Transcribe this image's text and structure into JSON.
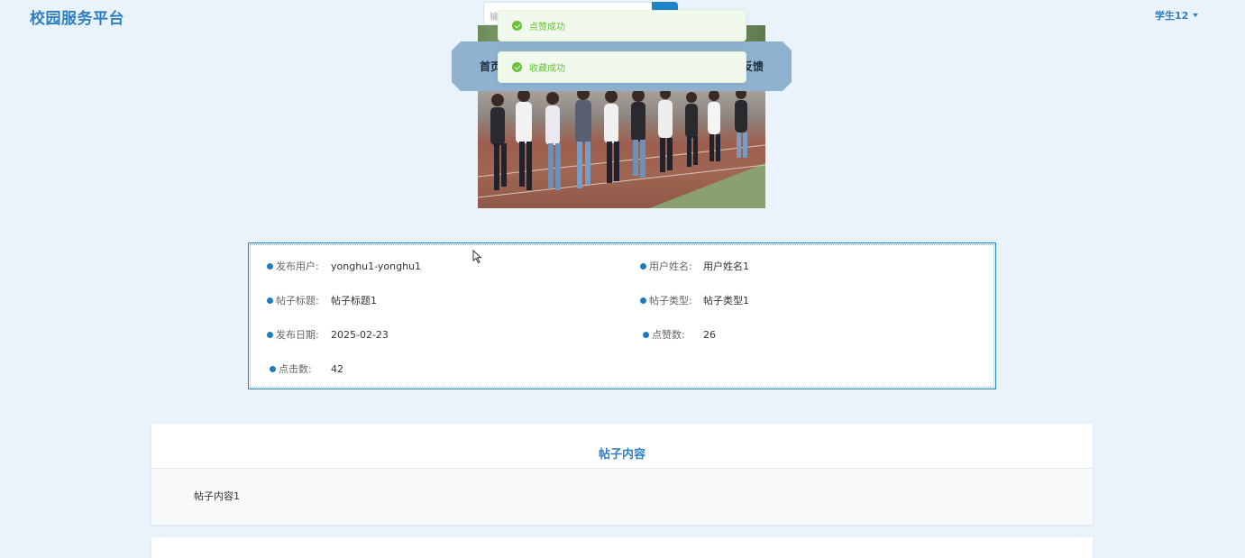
{
  "header": {
    "brand": "校园服务平台",
    "user_label": "学生12",
    "search_placeholder": "输入"
  },
  "nav": {
    "items": [
      {
        "label": "首页"
      },
      {
        "label": "反馈"
      }
    ]
  },
  "toasts": [
    {
      "message": "点赞成功"
    },
    {
      "message": "收藏成功"
    }
  ],
  "details": {
    "publisher_label": "发布用户:",
    "publisher_value": "yonghu1-yonghu1",
    "username_label": "用户姓名:",
    "username_value": "用户姓名1",
    "title_label": "帖子标题:",
    "title_value": "帖子标题1",
    "type_label": "帖子类型:",
    "type_value": "帖子类型1",
    "date_label": "发布日期:",
    "date_value": "2025-02-23",
    "likes_label": "点赞数:",
    "likes_value": "26",
    "clicks_label": "点击数:",
    "clicks_value": "42"
  },
  "content": {
    "heading": "帖子内容",
    "text": "帖子内容1"
  },
  "colors": {
    "accent": "#2d7fc1",
    "background": "#eaf3fc",
    "success": "#67c23a"
  }
}
